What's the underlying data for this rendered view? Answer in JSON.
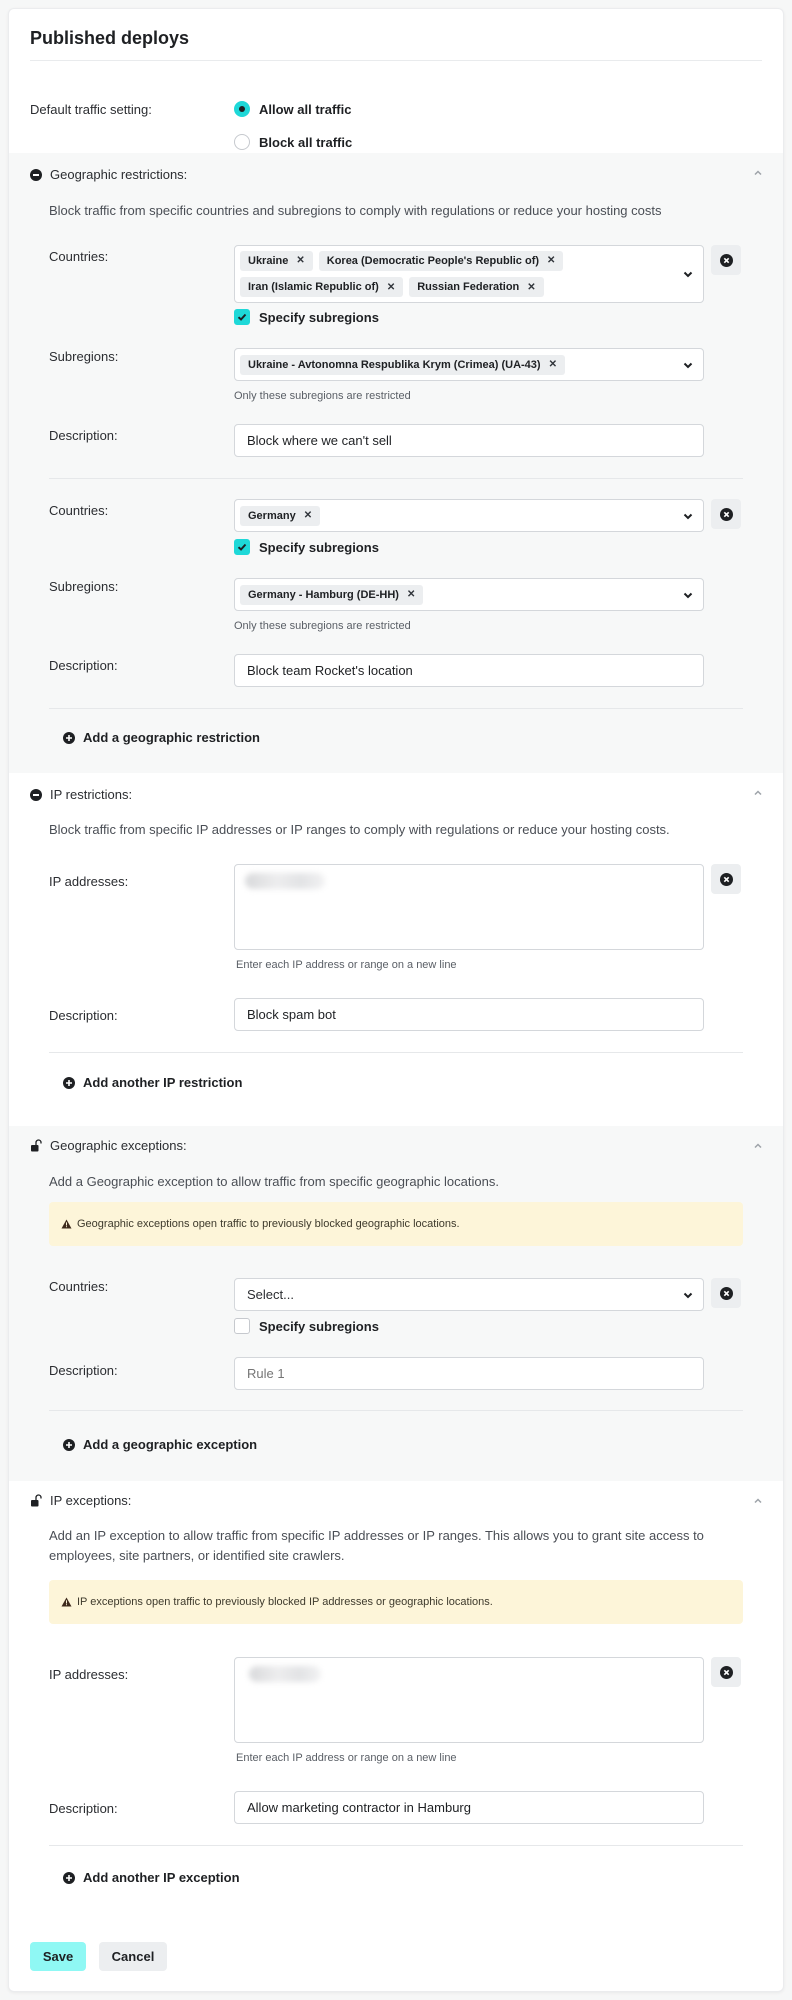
{
  "page": {
    "title": "Published deploys"
  },
  "default_traffic": {
    "label": "Default traffic setting:",
    "options": [
      {
        "label": "Allow all traffic",
        "selected": true
      },
      {
        "label": "Block all traffic",
        "selected": false
      }
    ]
  },
  "geo_restrictions": {
    "heading": "Geographic restrictions:",
    "description": "Block traffic from specific countries and subregions to comply with regulations or reduce your hosting costs",
    "rules": [
      {
        "countries_label": "Countries:",
        "countries": [
          "Ukraine",
          "Korea (Democratic People's Republic of)",
          "Iran (Islamic Republic of)",
          "Russian Federation"
        ],
        "specify_subregions_label": "Specify subregions",
        "specify_subregions": true,
        "subregions_label": "Subregions:",
        "subregions": [
          "Ukraine - Avtonomna Respublika Krym (Crimea) (UA-43)"
        ],
        "subregions_hint": "Only these subregions are restricted",
        "description_label": "Description:",
        "description_value": "Block where we can't sell"
      },
      {
        "countries_label": "Countries:",
        "countries": [
          "Germany"
        ],
        "specify_subregions_label": "Specify subregions",
        "specify_subregions": true,
        "subregions_label": "Subregions:",
        "subregions": [
          "Germany - Hamburg (DE-HH)"
        ],
        "subregions_hint": "Only these subregions are restricted",
        "description_label": "Description:",
        "description_value": "Block team Rocket's location"
      }
    ],
    "add_label": "Add a geographic restriction"
  },
  "ip_restrictions": {
    "heading": "IP restrictions:",
    "description": "Block traffic from specific IP addresses or IP ranges to comply with regulations or reduce your hosting costs.",
    "ip_label": "IP addresses:",
    "ip_value_redacted": true,
    "ip_hint": "Enter each IP address or range on a new line",
    "description_label": "Description:",
    "description_value": "Block spam bot",
    "add_label": "Add another IP restriction"
  },
  "geo_exceptions": {
    "heading": "Geographic exceptions:",
    "description": "Add a Geographic exception to allow traffic from specific geographic locations.",
    "warning": "Geographic exceptions open traffic to previously blocked geographic locations.",
    "countries_label": "Countries:",
    "countries_placeholder": "Select...",
    "specify_subregions_label": "Specify subregions",
    "specify_subregions": false,
    "description_label": "Description:",
    "description_placeholder": "Rule 1",
    "add_label": "Add a geographic exception"
  },
  "ip_exceptions": {
    "heading": "IP exceptions:",
    "description": "Add an IP exception to allow traffic from specific IP addresses or IP ranges. This allows you to grant site access to employees, site partners, or identified site crawlers.",
    "warning": "IP exceptions open traffic to previously blocked IP addresses or geographic locations.",
    "ip_label": "IP addresses:",
    "ip_value_redacted": true,
    "ip_hint": "Enter each IP address or range on a new line",
    "description_label": "Description:",
    "description_value": "Allow marketing contractor in Hamburg",
    "add_label": "Add another IP exception"
  },
  "actions": {
    "save": "Save",
    "cancel": "Cancel"
  },
  "colors": {
    "accent": "#1ed8d8",
    "save_button": "#8ff8f4",
    "warning_bg": "#fdf5d9"
  }
}
